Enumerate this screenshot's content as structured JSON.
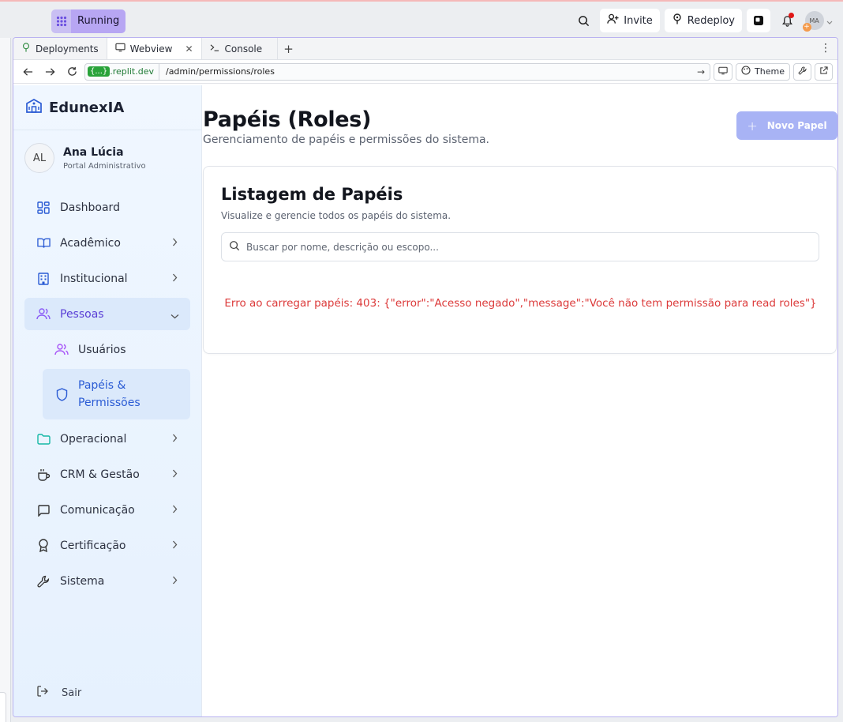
{
  "topbar": {
    "run_label": "Running",
    "invite_label": "Invite",
    "redeploy_label": "Redeploy",
    "avatar_initials": "MA"
  },
  "tabs": [
    {
      "label": "Deployments"
    },
    {
      "label": "Webview"
    },
    {
      "label": "Console"
    }
  ],
  "urlbar": {
    "domain_pill": "{...}",
    "domain": ".replit.dev",
    "path": "/admin/permissions/roles",
    "theme_label": "Theme"
  },
  "sidebar": {
    "brand": "EdunexIA",
    "user": {
      "initials": "AL",
      "name": "Ana Lúcia",
      "role": "Portal Administrativo"
    },
    "items": [
      {
        "label": "Dashboard"
      },
      {
        "label": "Acadêmico"
      },
      {
        "label": "Institucional"
      },
      {
        "label": "Pessoas"
      },
      {
        "label": "Operacional"
      },
      {
        "label": "CRM & Gestão"
      },
      {
        "label": "Comunicação"
      },
      {
        "label": "Certificação"
      },
      {
        "label": "Sistema"
      }
    ],
    "sub_items": [
      {
        "label": "Usuários"
      },
      {
        "label": "Papéis & Permissões"
      }
    ],
    "logout_label": "Sair"
  },
  "main": {
    "title": "Papéis (Roles)",
    "subtitle": "Gerenciamento de papéis e permissões do sistema.",
    "new_button": "Novo Papel",
    "card_title": "Listagem de Papéis",
    "card_subtitle": "Visualize e gerencie todos os papéis do sistema.",
    "search_placeholder": "Buscar por nome, descrição ou escopo...",
    "error": "Erro ao carregar papéis: 403: {\"error\":\"Acesso negado\",\"message\":\"Você não tem permissão para read roles\"}"
  },
  "colors": {
    "accent": "#5a3fd6",
    "error": "#dc3a3a",
    "primary_disabled": "#a8b3f5"
  }
}
